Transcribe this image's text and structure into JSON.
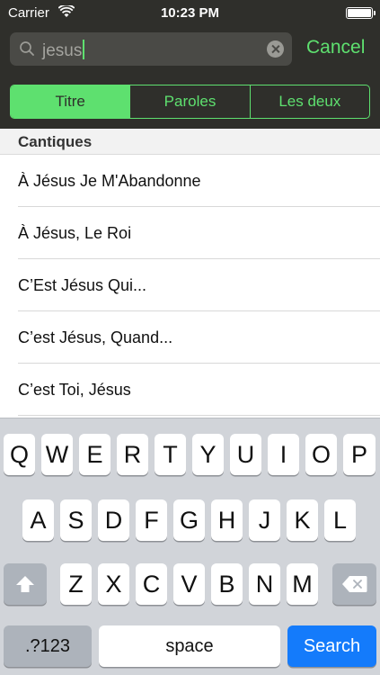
{
  "status_bar": {
    "carrier": "Carrier",
    "time": "10:23 PM"
  },
  "search": {
    "value": "jesus",
    "cancel_label": "Cancel"
  },
  "segments": [
    {
      "label": "Titre",
      "selected": true
    },
    {
      "label": "Paroles",
      "selected": false
    },
    {
      "label": "Les deux",
      "selected": false
    }
  ],
  "section": {
    "title": "Cantiques"
  },
  "results": [
    "À Jésus Je M'Abandonne",
    "À Jésus, Le Roi",
    "C’Est Jésus Qui...",
    "C’est Jésus, Quand...",
    "C’est Toi, Jésus"
  ],
  "keyboard": {
    "row1": [
      "Q",
      "W",
      "E",
      "R",
      "T",
      "Y",
      "U",
      "I",
      "O",
      "P"
    ],
    "row2": [
      "A",
      "S",
      "D",
      "F",
      "G",
      "H",
      "J",
      "K",
      "L"
    ],
    "row3": [
      "Z",
      "X",
      "C",
      "V",
      "B",
      "N",
      "M"
    ],
    "numbers_label": ".?123",
    "space_label": "space",
    "search_label": "Search"
  },
  "colors": {
    "accent": "#5ee06f",
    "dark_bg": "#2f2f2b",
    "key_search": "#147bfb"
  }
}
